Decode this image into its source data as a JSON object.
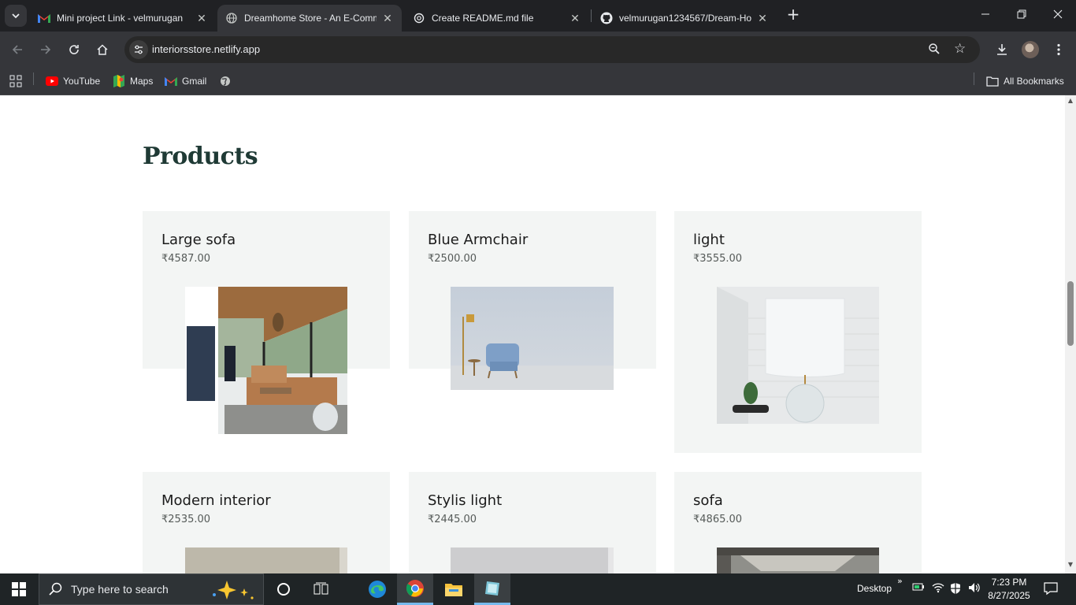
{
  "browser": {
    "tabs": [
      {
        "title": "Mini project Link - velmurugan",
        "icon": "gmail-icon"
      },
      {
        "title": "Dreamhome Store - An E-Comm",
        "icon": "page-icon",
        "active": true
      },
      {
        "title": "Create README.md file",
        "icon": "chatgpt-icon"
      },
      {
        "title": "velmurugan1234567/Dream-Ho",
        "icon": "github-icon"
      }
    ],
    "url": "interiorsstore.netlify.app",
    "bookmarks": [
      {
        "label": "YouTube",
        "icon": "youtube-icon"
      },
      {
        "label": "Maps",
        "icon": "maps-icon"
      },
      {
        "label": "Gmail",
        "icon": "gmail-icon"
      }
    ],
    "all_bookmarks": "All Bookmarks"
  },
  "page": {
    "title": "Products",
    "products": [
      {
        "name": "Large sofa",
        "price": "₹4587.00"
      },
      {
        "name": "Blue Armchair",
        "price": "₹2500.00"
      },
      {
        "name": "light",
        "price": "₹3555.00"
      },
      {
        "name": "Modern interior",
        "price": "₹2535.00"
      },
      {
        "name": "Stylis light",
        "price": "₹2445.00"
      },
      {
        "name": "sofa",
        "price": "₹4865.00"
      }
    ]
  },
  "taskbar": {
    "search_placeholder": "Type here to search",
    "desktop_label": "Desktop",
    "time": "7:23 PM",
    "date": "8/27/2025"
  }
}
